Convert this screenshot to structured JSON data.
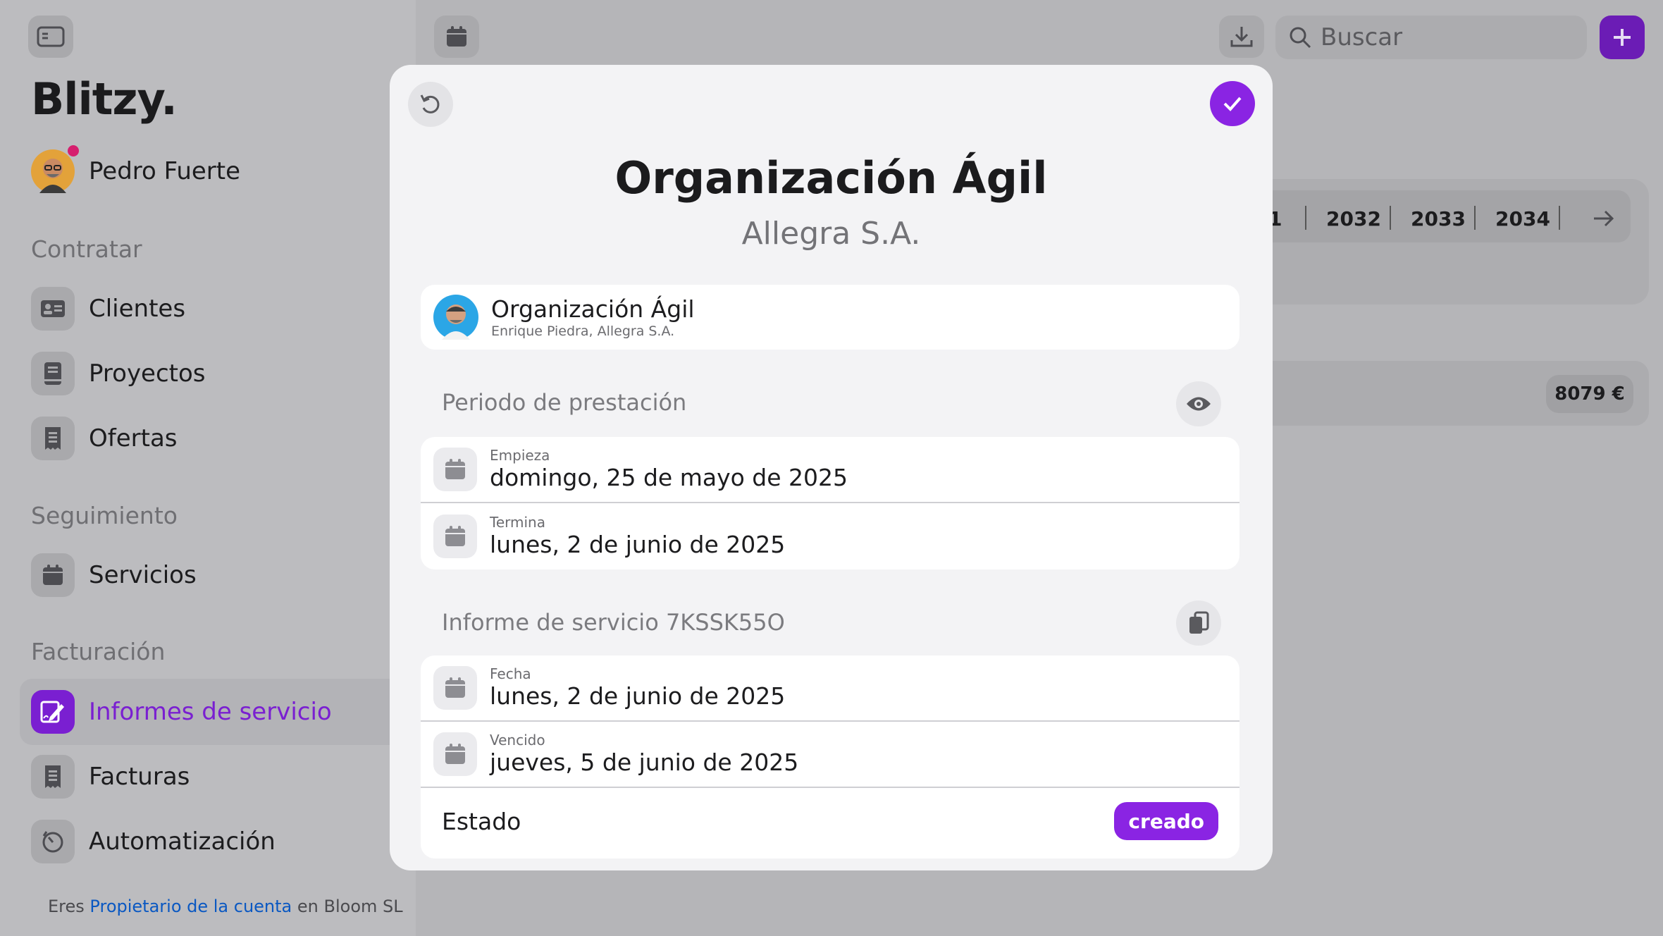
{
  "app": {
    "logo": "Blitzy.",
    "user_name": "Pedro Fuerte"
  },
  "sidebar": {
    "sections": [
      {
        "title": "Contratar",
        "items": [
          {
            "label": "Clientes",
            "icon": "contact-card-icon"
          },
          {
            "label": "Proyectos",
            "icon": "notebook-icon"
          },
          {
            "label": "Ofertas",
            "icon": "receipt-icon"
          }
        ]
      },
      {
        "title": "Seguimiento",
        "items": [
          {
            "label": "Servicios",
            "icon": "calendar-icon"
          }
        ]
      },
      {
        "title": "Facturación",
        "items": [
          {
            "label": "Informes de servicio",
            "icon": "signature-icon",
            "active": true
          },
          {
            "label": "Facturas",
            "icon": "receipt-icon"
          },
          {
            "label": "Automatización",
            "icon": "timer-icon"
          }
        ]
      }
    ],
    "footer": {
      "prefix": "Eres",
      "link": "Propietario de la cuenta",
      "suffix": "en Bloom SL"
    }
  },
  "toolbar": {
    "search_placeholder": "Buscar"
  },
  "background": {
    "years": [
      "1",
      "2032",
      "2033",
      "2034"
    ],
    "amount": "8079 €"
  },
  "modal": {
    "title": "Organización Ágil",
    "subtitle": "Allegra S.A.",
    "client": {
      "name": "Organización Ágil",
      "detail": "Enrique Piedra, Allegra S.A."
    },
    "period": {
      "label": "Periodo de prestación",
      "start_label": "Empieza",
      "start_value": "domingo, 25 de mayo de 2025",
      "end_label": "Termina",
      "end_value": "lunes, 2 de junio de 2025"
    },
    "report": {
      "label": "Informe de servicio 7KSSK55O",
      "date_label": "Fecha",
      "date_value": "lunes, 2 de junio de 2025",
      "due_label": "Vencido",
      "due_value": "jueves, 5 de junio de 2025"
    },
    "status": {
      "label": "Estado",
      "value": "creado"
    }
  },
  "colors": {
    "accent": "#8a24e3",
    "accent_dim": "#7a1fd1",
    "link": "#0a58c2"
  }
}
